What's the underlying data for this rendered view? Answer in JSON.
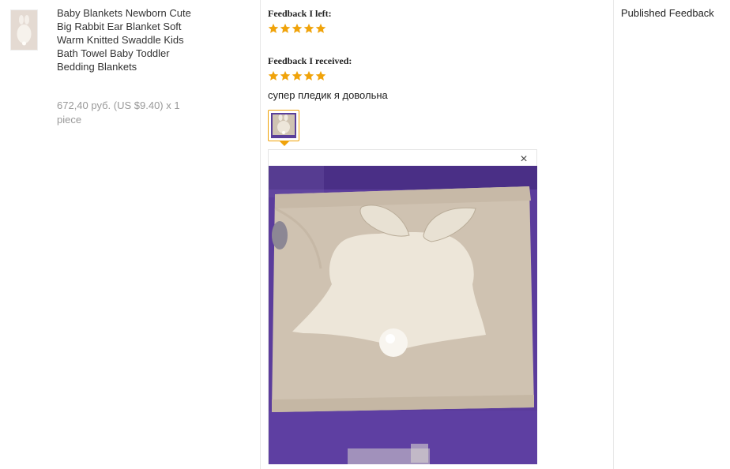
{
  "product": {
    "name": "Baby Blankets Newborn Cute Big Rabbit Ear Blanket Soft Warm Knitted Swaddle Kids Bath Towel Baby Toddler Bedding Blankets",
    "price_line": "672,40 руб. (US $9.40) x 1 piece"
  },
  "feedback": {
    "left_heading": "Feedback I left:",
    "left_rating": 5,
    "received_heading": "Feedback I received:",
    "received_rating": 5,
    "comment": "супер пледик я довольна",
    "star_color": "#f0a30a",
    "close_icon": "×"
  },
  "status": {
    "published_label": "Published Feedback"
  },
  "colors": {
    "accent": "#f0a30a",
    "price_text": "#999999",
    "divider": "#e8e8e8"
  }
}
